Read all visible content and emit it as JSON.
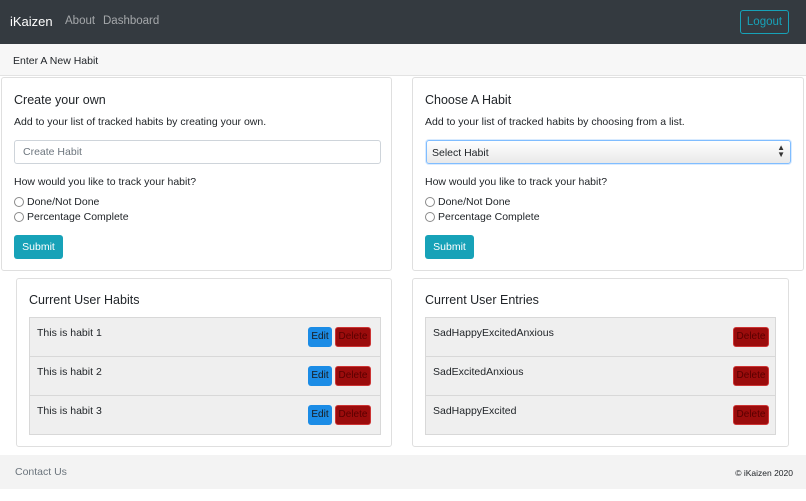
{
  "navbar": {
    "brand": "iKaizen",
    "links": [
      "About",
      "Dashboard"
    ],
    "logout_label": "Logout"
  },
  "subheader": {
    "title": "Enter A New Habit"
  },
  "create_card": {
    "title": "Create your own",
    "description": "Add to your list of tracked habits by creating your own.",
    "input_placeholder": "Create Habit",
    "question": "How would you like to track your habit?",
    "options": [
      "Done/Not Done",
      "Percentage Complete"
    ],
    "submit_label": "Submit"
  },
  "choose_card": {
    "title": "Choose A Habit",
    "description": "Add to your list of tracked habits by choosing from a list.",
    "select_value": "Select Habit",
    "question": "How would you like to track your habit?",
    "options": [
      "Done/Not Done",
      "Percentage Complete"
    ],
    "submit_label": "Submit"
  },
  "habits_card": {
    "title": "Current User Habits",
    "items": [
      "This is habit 1",
      "This is habit 2",
      "This is habit 3"
    ],
    "edit_label": "Edit",
    "delete_label": "Delete"
  },
  "entries_card": {
    "title": "Current User Entries",
    "items": [
      "SadHappyExcitedAnxious",
      "SadExcitedAnxious",
      "SadHappyExcited"
    ],
    "delete_label": "Delete"
  },
  "footer": {
    "contact": "Contact Us",
    "copyright": "© iKaizen 2020"
  },
  "colors": {
    "navbar": "#343a40",
    "accent": "#17a2b8",
    "edit": "#1b8ce6",
    "delete": "#9b0c0c"
  }
}
